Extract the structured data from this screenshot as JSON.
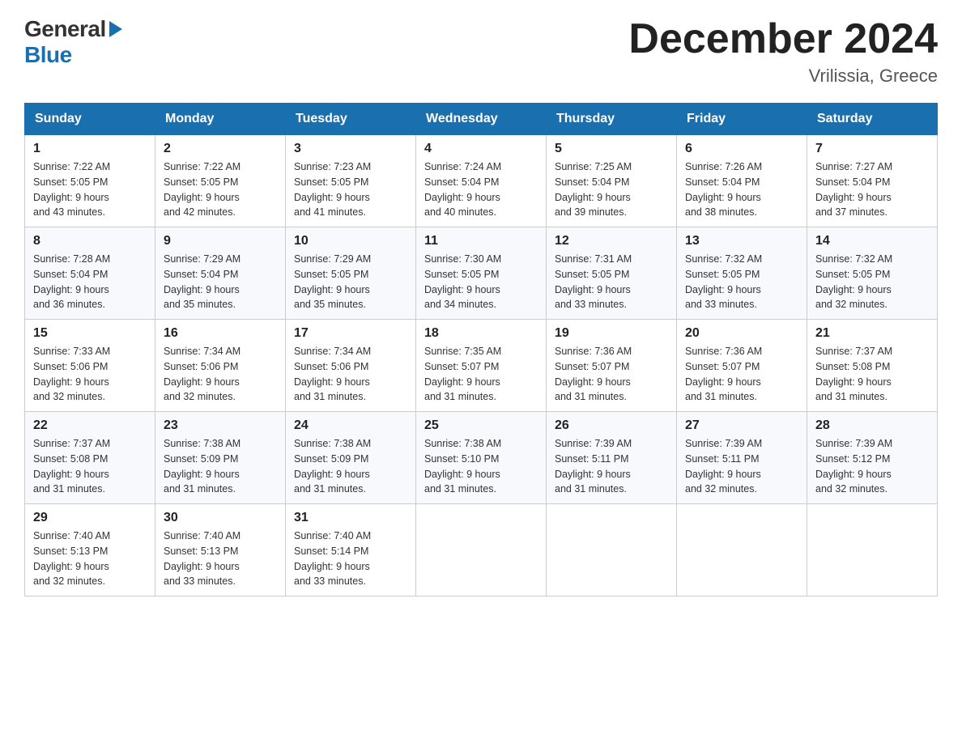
{
  "header": {
    "logo_general": "General",
    "logo_blue": "Blue",
    "month_title": "December 2024",
    "location": "Vrilissia, Greece"
  },
  "weekdays": [
    "Sunday",
    "Monday",
    "Tuesday",
    "Wednesday",
    "Thursday",
    "Friday",
    "Saturday"
  ],
  "weeks": [
    [
      {
        "day": "1",
        "sunrise": "7:22 AM",
        "sunset": "5:05 PM",
        "daylight": "9 hours and 43 minutes."
      },
      {
        "day": "2",
        "sunrise": "7:22 AM",
        "sunset": "5:05 PM",
        "daylight": "9 hours and 42 minutes."
      },
      {
        "day": "3",
        "sunrise": "7:23 AM",
        "sunset": "5:05 PM",
        "daylight": "9 hours and 41 minutes."
      },
      {
        "day": "4",
        "sunrise": "7:24 AM",
        "sunset": "5:04 PM",
        "daylight": "9 hours and 40 minutes."
      },
      {
        "day": "5",
        "sunrise": "7:25 AM",
        "sunset": "5:04 PM",
        "daylight": "9 hours and 39 minutes."
      },
      {
        "day": "6",
        "sunrise": "7:26 AM",
        "sunset": "5:04 PM",
        "daylight": "9 hours and 38 minutes."
      },
      {
        "day": "7",
        "sunrise": "7:27 AM",
        "sunset": "5:04 PM",
        "daylight": "9 hours and 37 minutes."
      }
    ],
    [
      {
        "day": "8",
        "sunrise": "7:28 AM",
        "sunset": "5:04 PM",
        "daylight": "9 hours and 36 minutes."
      },
      {
        "day": "9",
        "sunrise": "7:29 AM",
        "sunset": "5:04 PM",
        "daylight": "9 hours and 35 minutes."
      },
      {
        "day": "10",
        "sunrise": "7:29 AM",
        "sunset": "5:05 PM",
        "daylight": "9 hours and 35 minutes."
      },
      {
        "day": "11",
        "sunrise": "7:30 AM",
        "sunset": "5:05 PM",
        "daylight": "9 hours and 34 minutes."
      },
      {
        "day": "12",
        "sunrise": "7:31 AM",
        "sunset": "5:05 PM",
        "daylight": "9 hours and 33 minutes."
      },
      {
        "day": "13",
        "sunrise": "7:32 AM",
        "sunset": "5:05 PM",
        "daylight": "9 hours and 33 minutes."
      },
      {
        "day": "14",
        "sunrise": "7:32 AM",
        "sunset": "5:05 PM",
        "daylight": "9 hours and 32 minutes."
      }
    ],
    [
      {
        "day": "15",
        "sunrise": "7:33 AM",
        "sunset": "5:06 PM",
        "daylight": "9 hours and 32 minutes."
      },
      {
        "day": "16",
        "sunrise": "7:34 AM",
        "sunset": "5:06 PM",
        "daylight": "9 hours and 32 minutes."
      },
      {
        "day": "17",
        "sunrise": "7:34 AM",
        "sunset": "5:06 PM",
        "daylight": "9 hours and 31 minutes."
      },
      {
        "day": "18",
        "sunrise": "7:35 AM",
        "sunset": "5:07 PM",
        "daylight": "9 hours and 31 minutes."
      },
      {
        "day": "19",
        "sunrise": "7:36 AM",
        "sunset": "5:07 PM",
        "daylight": "9 hours and 31 minutes."
      },
      {
        "day": "20",
        "sunrise": "7:36 AM",
        "sunset": "5:07 PM",
        "daylight": "9 hours and 31 minutes."
      },
      {
        "day": "21",
        "sunrise": "7:37 AM",
        "sunset": "5:08 PM",
        "daylight": "9 hours and 31 minutes."
      }
    ],
    [
      {
        "day": "22",
        "sunrise": "7:37 AM",
        "sunset": "5:08 PM",
        "daylight": "9 hours and 31 minutes."
      },
      {
        "day": "23",
        "sunrise": "7:38 AM",
        "sunset": "5:09 PM",
        "daylight": "9 hours and 31 minutes."
      },
      {
        "day": "24",
        "sunrise": "7:38 AM",
        "sunset": "5:09 PM",
        "daylight": "9 hours and 31 minutes."
      },
      {
        "day": "25",
        "sunrise": "7:38 AM",
        "sunset": "5:10 PM",
        "daylight": "9 hours and 31 minutes."
      },
      {
        "day": "26",
        "sunrise": "7:39 AM",
        "sunset": "5:11 PM",
        "daylight": "9 hours and 31 minutes."
      },
      {
        "day": "27",
        "sunrise": "7:39 AM",
        "sunset": "5:11 PM",
        "daylight": "9 hours and 32 minutes."
      },
      {
        "day": "28",
        "sunrise": "7:39 AM",
        "sunset": "5:12 PM",
        "daylight": "9 hours and 32 minutes."
      }
    ],
    [
      {
        "day": "29",
        "sunrise": "7:40 AM",
        "sunset": "5:13 PM",
        "daylight": "9 hours and 32 minutes."
      },
      {
        "day": "30",
        "sunrise": "7:40 AM",
        "sunset": "5:13 PM",
        "daylight": "9 hours and 33 minutes."
      },
      {
        "day": "31",
        "sunrise": "7:40 AM",
        "sunset": "5:14 PM",
        "daylight": "9 hours and 33 minutes."
      },
      null,
      null,
      null,
      null
    ]
  ],
  "labels": {
    "sunrise": "Sunrise:",
    "sunset": "Sunset:",
    "daylight": "Daylight:"
  }
}
